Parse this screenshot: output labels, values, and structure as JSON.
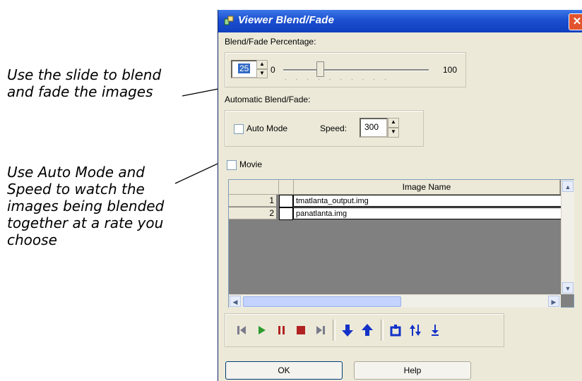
{
  "annotations": {
    "slide_note": "Use the slide to blend\nand fade the images",
    "auto_note": "Use Auto Mode and\nSpeed to watch the\nimages being blended\ntogether at a rate you\nchoose"
  },
  "window": {
    "title": "Viewer Blend/Fade",
    "close_glyph": "✕"
  },
  "blend": {
    "label": "Blend/Fade Percentage:",
    "value": "25",
    "min_label": "0",
    "max_label": "100",
    "slider_fraction": 0.25
  },
  "automatic": {
    "label": "Automatic Blend/Fade:",
    "auto_mode_label": "Auto Mode",
    "speed_label": "Speed:",
    "speed_value": "300"
  },
  "movie": {
    "label": "Movie"
  },
  "table": {
    "column_header": "Image Name",
    "rows": [
      {
        "num": "1",
        "name": "tmatlanta_output.img"
      },
      {
        "num": "2",
        "name": "panatlanta.img"
      }
    ]
  },
  "toolbar": {
    "icons": [
      "skip-start-icon",
      "play-icon",
      "pause-icon",
      "stop-icon",
      "skip-end-icon",
      "move-down-icon",
      "move-up-icon",
      "reset-icon",
      "swap-icon",
      "bottom-icon"
    ],
    "colors": {
      "gray": "#7a7a8c",
      "green": "#2e9c2e",
      "red": "#b22222",
      "blue": "#1432c8"
    }
  },
  "buttons": {
    "ok": "OK",
    "help": "Help"
  }
}
